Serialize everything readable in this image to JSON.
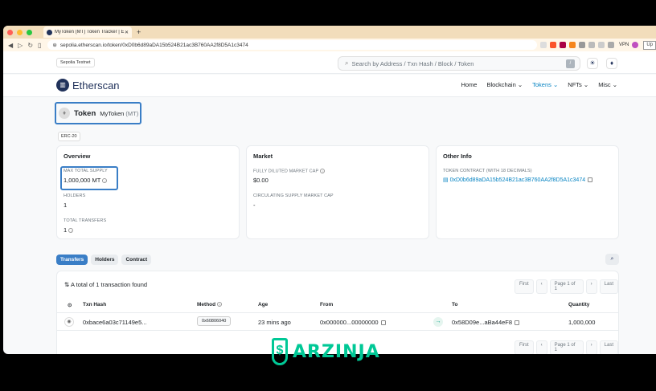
{
  "browser": {
    "tab_title": "MyToken (MT) Token Tracker | E",
    "new_tab": "+",
    "url": "sepolia.etherscan.io/token/0xD0b6d89aDA15b524B21ac3B760AA2f8D5A1c3474",
    "vpn": "VPN",
    "profile_btn": "Up"
  },
  "header": {
    "network": "Sepolia Testnet",
    "search_placeholder": "Search by Address / Txn Hash / Block / Token",
    "slash": "/"
  },
  "nav": {
    "logo": "Etherscan",
    "items": [
      "Home",
      "Blockchain",
      "Tokens",
      "NFTs",
      "Misc"
    ]
  },
  "token": {
    "word": "Token",
    "name": "MyToken",
    "symbol": "(MT)",
    "standard": "ERC-20"
  },
  "overview": {
    "title": "Overview",
    "max_supply_label": "MAX TOTAL SUPPLY",
    "max_supply_value": "1,000,000 MT",
    "holders_label": "HOLDERS",
    "holders_value": "1",
    "transfers_label": "TOTAL TRANSFERS",
    "transfers_value": "1"
  },
  "market": {
    "title": "Market",
    "fdmc_label": "FULLY DILUTED MARKET CAP",
    "fdmc_value": "$0.00",
    "csmc_label": "CIRCULATING SUPPLY MARKET CAP",
    "csmc_value": "-"
  },
  "other": {
    "title": "Other Info",
    "contract_label": "TOKEN CONTRACT (WITH 18 DECIMALS)",
    "contract_value": "0xD0b6d89aDA15b524B21ac3B760AA2f8D5A1c3474"
  },
  "tabs": [
    "Transfers",
    "Holders",
    "Contract"
  ],
  "table": {
    "found": "A total of 1 transaction found",
    "pager": [
      "First",
      "‹",
      "Page 1 of 1",
      "›",
      "Last"
    ],
    "headers": [
      "Txn Hash",
      "Method",
      "Age",
      "From",
      "To",
      "Quantity"
    ],
    "row": {
      "hash": "0xbace6a03c71149e5...",
      "method": "0x60806040",
      "age": "23 mins ago",
      "from": "0x000000...00000000",
      "to": "0x58D09e...aBa44eF8",
      "quantity": "1,000,000"
    }
  },
  "watermark": {
    "text": "ARZINJA"
  }
}
